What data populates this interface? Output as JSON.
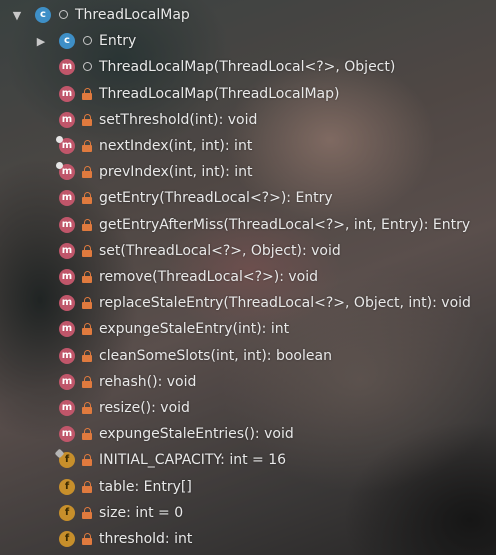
{
  "tree": {
    "nodes": [
      {
        "depth": 0,
        "expand": "expanded",
        "kind": "class",
        "letter": "c",
        "vis": "package",
        "label": "ThreadLocalMap"
      },
      {
        "depth": 1,
        "expand": "collapsed",
        "kind": "class",
        "letter": "c",
        "vis": "package",
        "label": "Entry"
      },
      {
        "depth": 1,
        "kind": "method",
        "letter": "m",
        "vis": "package",
        "label": "ThreadLocalMap(ThreadLocal<?>, Object)"
      },
      {
        "depth": 1,
        "kind": "method",
        "letter": "m",
        "vis": "private",
        "label": "ThreadLocalMap(ThreadLocalMap)"
      },
      {
        "depth": 1,
        "kind": "method",
        "letter": "m",
        "vis": "private",
        "label": "setThreshold(int): void"
      },
      {
        "depth": 1,
        "kind": "method",
        "letter": "m",
        "vis": "private",
        "overlay": "static",
        "label": "nextIndex(int, int): int"
      },
      {
        "depth": 1,
        "kind": "method",
        "letter": "m",
        "vis": "private",
        "overlay": "static",
        "label": "prevIndex(int, int): int"
      },
      {
        "depth": 1,
        "kind": "method",
        "letter": "m",
        "vis": "private",
        "label": "getEntry(ThreadLocal<?>): Entry"
      },
      {
        "depth": 1,
        "kind": "method",
        "letter": "m",
        "vis": "private",
        "label": "getEntryAfterMiss(ThreadLocal<?>, int, Entry): Entry"
      },
      {
        "depth": 1,
        "kind": "method",
        "letter": "m",
        "vis": "private",
        "label": "set(ThreadLocal<?>, Object): void"
      },
      {
        "depth": 1,
        "kind": "method",
        "letter": "m",
        "vis": "private",
        "label": "remove(ThreadLocal<?>): void"
      },
      {
        "depth": 1,
        "kind": "method",
        "letter": "m",
        "vis": "private",
        "label": "replaceStaleEntry(ThreadLocal<?>, Object, int): void"
      },
      {
        "depth": 1,
        "kind": "method",
        "letter": "m",
        "vis": "private",
        "label": "expungeStaleEntry(int): int"
      },
      {
        "depth": 1,
        "kind": "method",
        "letter": "m",
        "vis": "private",
        "label": "cleanSomeSlots(int, int): boolean"
      },
      {
        "depth": 1,
        "kind": "method",
        "letter": "m",
        "vis": "private",
        "label": "rehash(): void"
      },
      {
        "depth": 1,
        "kind": "method",
        "letter": "m",
        "vis": "private",
        "label": "resize(): void"
      },
      {
        "depth": 1,
        "kind": "method",
        "letter": "m",
        "vis": "private",
        "label": "expungeStaleEntries(): void"
      },
      {
        "depth": 1,
        "kind": "field",
        "letter": "f",
        "vis": "private",
        "overlay": "final",
        "label": "INITIAL_CAPACITY: int = 16"
      },
      {
        "depth": 1,
        "kind": "field",
        "letter": "f",
        "vis": "private",
        "label": "table: Entry[]"
      },
      {
        "depth": 1,
        "kind": "field",
        "letter": "f",
        "vis": "private",
        "label": "size: int = 0"
      },
      {
        "depth": 1,
        "kind": "field",
        "letter": "f",
        "vis": "private",
        "label": "threshold: int"
      }
    ]
  },
  "colors": {
    "class_badge": "#3e8fc7",
    "method_badge": "#c0566a",
    "field_badge": "#c78f2b",
    "private_lock": "#e07a3e",
    "text": "#e9e9e9"
  }
}
